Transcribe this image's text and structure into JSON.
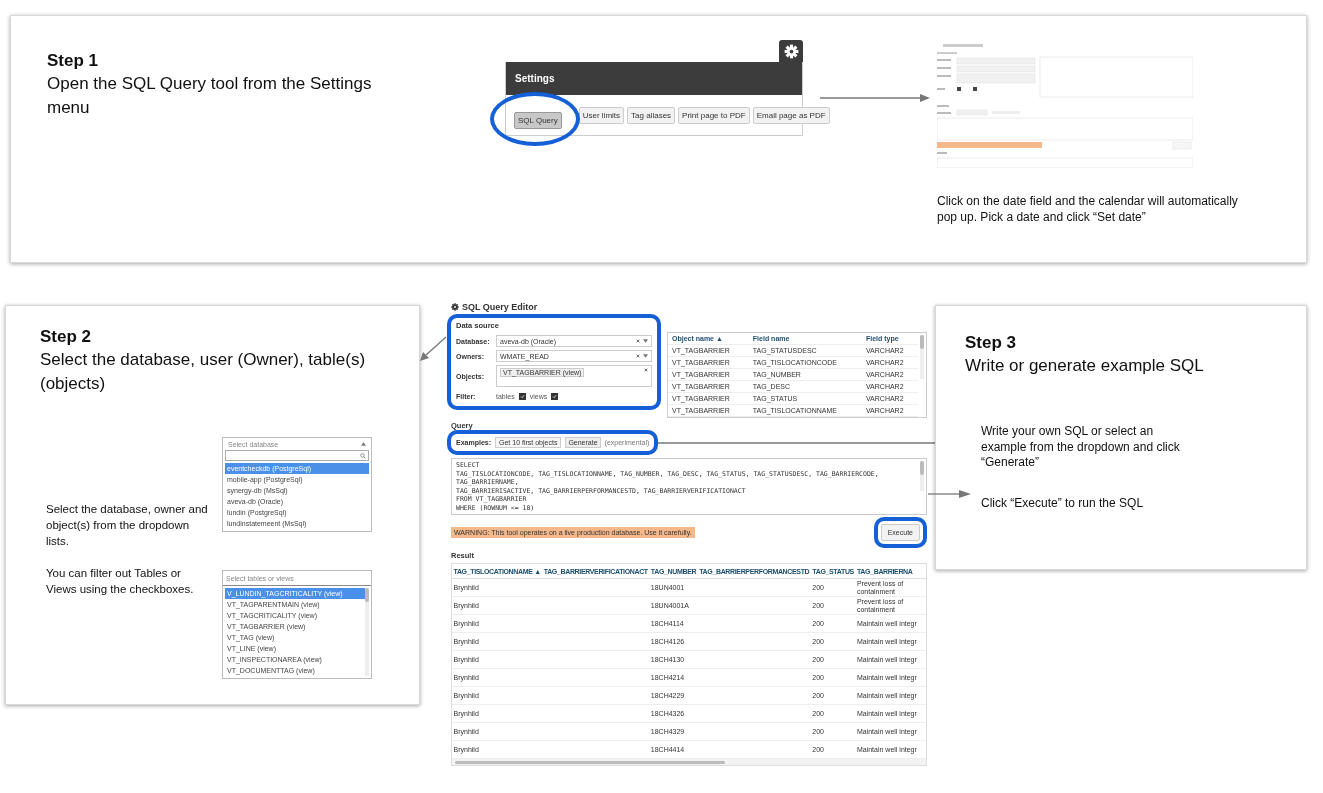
{
  "step1": {
    "title": "Step 1",
    "text": "Open the SQL Query tool from the Settings menu",
    "settings": {
      "title": "Settings",
      "buttons": [
        {
          "label": "SQL Query",
          "selected": true
        },
        {
          "label": "User limits",
          "selected": false
        },
        {
          "label": "Tag aliases",
          "selected": false
        },
        {
          "label": "Print page to PDF",
          "selected": false
        },
        {
          "label": "Email page as PDF",
          "selected": false
        }
      ]
    },
    "caption": "Click on the date field and the calendar will automatically pop up.  Pick a date and click “Set date”"
  },
  "step2": {
    "title": "Step 2",
    "text": "Select the database, user (Owner), table(s) (objects)",
    "notes": [
      "Select the database, owner and object(s) from the dropdown lists.",
      "You can filter out Tables or Views using the checkboxes."
    ],
    "database_dropdown": {
      "placeholder": "Select database",
      "options": [
        {
          "label": "eventcheckdb (PostgreSql)",
          "selected": true
        },
        {
          "label": "mobile-app (PostgreSql)",
          "selected": false
        },
        {
          "label": "synergy-db (MsSql)",
          "selected": false
        },
        {
          "label": "aveva-db (Oracle)",
          "selected": false
        },
        {
          "label": "lundin (PostgreSql)",
          "selected": false
        },
        {
          "label": "lundinstatemeent (MsSql)",
          "selected": false
        }
      ]
    },
    "objects_dropdown": {
      "placeholder": "Select tables or views",
      "options": [
        {
          "label": "V_LUNDIN_TAGCRITICALITY (view)",
          "selected": true
        },
        {
          "label": "VT_TAGPARENTMAIN (view)",
          "selected": false
        },
        {
          "label": "VT_TAGCRITICALITY (view)",
          "selected": false
        },
        {
          "label": "VT_TAGBARRIER (view)",
          "selected": false
        },
        {
          "label": "VT_TAG (view)",
          "selected": false
        },
        {
          "label": "VT_LINE (view)",
          "selected": false
        },
        {
          "label": "VT_INSPECTIONAREA (view)",
          "selected": false
        },
        {
          "label": "VT_DOCUMENTTAG (view)",
          "selected": false
        }
      ]
    }
  },
  "editor": {
    "title": "SQL Query Editor",
    "section": "Data source",
    "fields": [
      {
        "kind": "select",
        "label": "Database:",
        "value": "aveva-db (Oracle)"
      },
      {
        "kind": "select",
        "label": "Owners:",
        "value": "WMATE_READ"
      },
      {
        "kind": "tags",
        "label": "Objects:",
        "tags": [
          "VT_TAGBARRIER (view)"
        ]
      },
      {
        "kind": "checks",
        "label": "Filter:",
        "options": [
          {
            "label": "tables",
            "checked": true
          },
          {
            "label": "views",
            "checked": true
          }
        ]
      }
    ],
    "schema_table": {
      "columns": [
        "Object name ▲",
        "Field name",
        "Field type"
      ],
      "rows": [
        [
          "VT_TAGBARRIER",
          "TAG_STATUSDESC",
          "VARCHAR2"
        ],
        [
          "VT_TAGBARRIER",
          "TAG_TISLOCATIONCODE",
          "VARCHAR2"
        ],
        [
          "VT_TAGBARRIER",
          "TAG_NUMBER",
          "VARCHAR2"
        ],
        [
          "VT_TAGBARRIER",
          "TAG_DESC",
          "VARCHAR2"
        ],
        [
          "VT_TAGBARRIER",
          "TAG_STATUS",
          "VARCHAR2"
        ],
        [
          "VT_TAGBARRIER",
          "TAG_TISLOCATIONNAME",
          "VARCHAR2"
        ]
      ]
    },
    "query_label": "Query",
    "examples_label": "Examples:",
    "example": "Get 10 first objects",
    "generate": "Generate",
    "experimental": "(experimental)",
    "sql": [
      "SELECT",
      "TAG_TISLOCATIONCODE, TAG_TISLOCATIONNAME, TAG_NUMBER, TAG_DESC, TAG_STATUS, TAG_STATUSDESC, TAG_BARRIERCODE, TAG_BARRIERNAME,",
      "TAG_BARRIERISACTIVE, TAG_BARRIERPERFORMANCESTD, TAG_BARRIERVERIFICATIONACT",
      "FROM VT_TAGBARRIER",
      "WHERE (ROWNUM <= 10)"
    ],
    "warning": "WARNING: This tool operates on a live production database. Use it carefully.",
    "execute": "Execute",
    "result_label": "Result",
    "results": {
      "columns": [
        "TAG_TISLOCATIONNAME ▲",
        "TAG_BARRIERVERIFICATIONACT",
        "TAG_NUMBER",
        "TAG_BARRIERPERFORMANCESTD",
        "TAG_STATUS",
        "TAG_BARRIERNA"
      ],
      "rows": [
        [
          "Brynhild",
          "",
          "18UN4001",
          "",
          "200",
          "Prevent loss of containment"
        ],
        [
          "Brynhild",
          "",
          "18UN4001A",
          "",
          "200",
          "Prevent loss of containment"
        ],
        [
          "Brynhild",
          "",
          "18CH4114",
          "",
          "200",
          "Maintain well integr"
        ],
        [
          "Brynhild",
          "",
          "18CH4126",
          "",
          "200",
          "Maintain well integr"
        ],
        [
          "Brynhild",
          "",
          "18CH4130",
          "",
          "200",
          "Maintain well integr"
        ],
        [
          "Brynhild",
          "",
          "18CH4214",
          "",
          "200",
          "Maintain well integr"
        ],
        [
          "Brynhild",
          "",
          "18CH4229",
          "",
          "200",
          "Maintain well integr"
        ],
        [
          "Brynhild",
          "",
          "18CH4326",
          "",
          "200",
          "Maintain well integr"
        ],
        [
          "Brynhild",
          "",
          "18CH4329",
          "",
          "200",
          "Maintain well integr"
        ],
        [
          "Brynhild",
          "",
          "18CH4414",
          "",
          "200",
          "Maintain well integr"
        ]
      ]
    }
  },
  "step3": {
    "title": "Step 3",
    "text": "Write or generate example SQL",
    "callouts": [
      "Write your own SQL or select an example from the dropdown and click “Generate”",
      "Click “Execute” to run the SQL"
    ]
  }
}
